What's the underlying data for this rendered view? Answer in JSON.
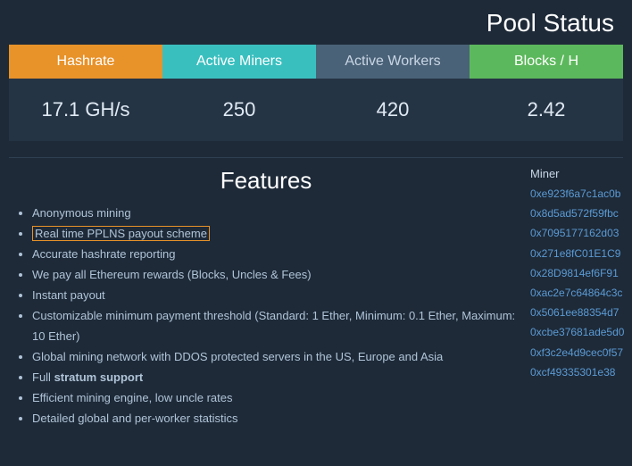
{
  "header": {
    "title": "Pool Status"
  },
  "stats": [
    {
      "id": "hashrate",
      "label": "Hashrate",
      "value": "17.1 GH/s",
      "labelClass": "hashrate"
    },
    {
      "id": "active-miners",
      "label": "Active Miners",
      "value": "250",
      "labelClass": "miners"
    },
    {
      "id": "active-workers",
      "label": "Active Workers",
      "value": "420",
      "labelClass": "workers"
    },
    {
      "id": "blocks",
      "label": "Blocks / H",
      "value": "2.42",
      "labelClass": "blocks"
    }
  ],
  "features": {
    "title": "Features",
    "items": [
      {
        "text": "Anonymous mining",
        "link": false,
        "bold": false
      },
      {
        "text": "Real time PPLNS payout scheme",
        "link": true,
        "bold": false
      },
      {
        "text": "Accurate hashrate reporting",
        "link": false,
        "bold": false
      },
      {
        "text": "We pay all Ethereum rewards (Blocks, Uncles & Fees)",
        "link": false,
        "bold": false
      },
      {
        "text": "Instant payout",
        "link": false,
        "bold": false
      },
      {
        "text": "Customizable minimum payment threshold (Standard: 1 Ether, Minimum: 0.1 Ether, Maximum: 10 Ether)",
        "link": false,
        "bold": false
      },
      {
        "text": "Global mining network with DDOS protected servers in the US, Europe and Asia",
        "link": false,
        "bold": false
      },
      {
        "text": "Full ",
        "link": false,
        "bold": false,
        "boldPart": "stratum support"
      },
      {
        "text": "Efficient mining engine, low uncle rates",
        "link": false,
        "bold": false
      },
      {
        "text": "Detailed global and per-worker statistics",
        "link": false,
        "bold": false
      }
    ]
  },
  "miners": {
    "column_header": "Miner",
    "addresses": [
      "0xe923f6a7c1ac0b",
      "0x8d5ad572f59fbc",
      "0x7095177162d03",
      "0x271e8fC01E1C9",
      "0x28D9814ef6F91",
      "0xac2e7c64864c3c",
      "0x5061ee88354d7",
      "0xcbe37681ade5d0",
      "0xf3c2e4d9cec0f57",
      "0xcf49335301e38"
    ]
  }
}
